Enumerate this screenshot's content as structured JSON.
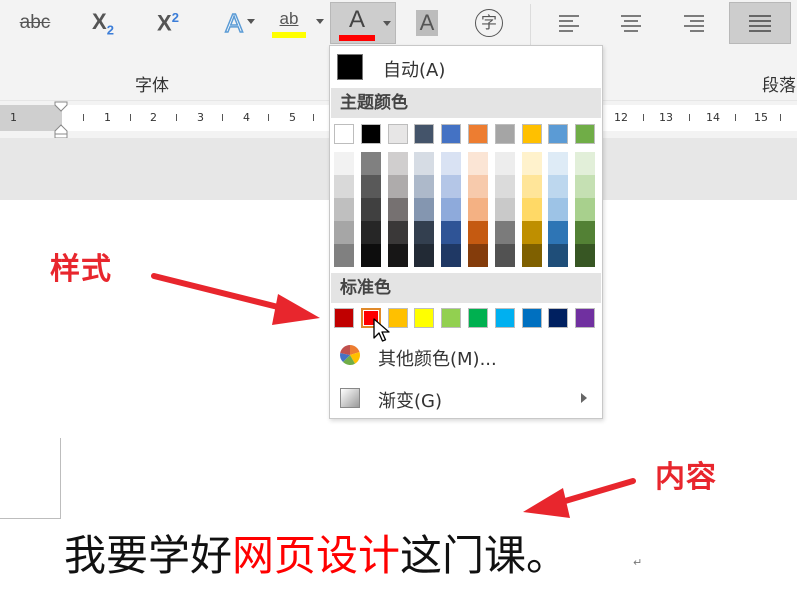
{
  "ribbon": {
    "buttons": {
      "strikethrough": "abc",
      "subscript_main": "X",
      "subscript_sub": "2",
      "superscript_main": "X",
      "superscript_sup": "2",
      "text_effects": "A",
      "highlight": "ab",
      "font_color": "A",
      "char_shading": "A",
      "enclose_char": "字"
    },
    "group_font_label": "字体",
    "group_paragraph_label": "段落",
    "colors": {
      "highlight_bar": "#ffff00",
      "font_color_bar": "#ff0000",
      "text_effect": "#5b9bd5"
    }
  },
  "ruler": {
    "left_label": "1",
    "numbers": [
      "1",
      "2",
      "3",
      "4",
      "5",
      "12",
      "13",
      "14",
      "15"
    ]
  },
  "color_menu": {
    "auto_label": "自动(A)",
    "theme_header": "主题颜色",
    "theme_top_row": [
      "#ffffff",
      "#000000",
      "#e7e6e6",
      "#44546a",
      "#4472c4",
      "#ed7d31",
      "#a5a5a5",
      "#ffc000",
      "#5b9bd5",
      "#70ad47"
    ],
    "theme_shades": [
      [
        "#f2f2f2",
        "#d9d9d9",
        "#bfbfbf",
        "#a6a6a6",
        "#808080"
      ],
      [
        "#808080",
        "#595959",
        "#404040",
        "#262626",
        "#0d0d0d"
      ],
      [
        "#d0cece",
        "#aeabab",
        "#767171",
        "#3a3838",
        "#171616"
      ],
      [
        "#d6dce4",
        "#adb9ca",
        "#8496b0",
        "#333f4f",
        "#222a35"
      ],
      [
        "#d9e2f3",
        "#b4c6e7",
        "#8eaadb",
        "#2f5496",
        "#1f3864"
      ],
      [
        "#fbe5d5",
        "#f7caac",
        "#f4b183",
        "#c55a11",
        "#843c0b"
      ],
      [
        "#ededed",
        "#dbdbdb",
        "#c9c9c9",
        "#7b7b7b",
        "#525252"
      ],
      [
        "#fff2cc",
        "#ffe599",
        "#ffd966",
        "#bf8f00",
        "#7f6000"
      ],
      [
        "#deebf6",
        "#bdd7ee",
        "#9dc3e6",
        "#2e75b5",
        "#1f4e79"
      ],
      [
        "#e2efd9",
        "#c5e0b3",
        "#a8d08d",
        "#538135",
        "#375623"
      ]
    ],
    "standard_header": "标准色",
    "standard_colors": [
      "#c00000",
      "#ff0000",
      "#ffc000",
      "#ffff00",
      "#92d050",
      "#00b050",
      "#00b0f0",
      "#0070c0",
      "#002060",
      "#7030a0"
    ],
    "more_colors_label": "其他颜色(M)...",
    "gradient_label": "渐变(G)"
  },
  "annotations": {
    "style_label": "样式",
    "content_label": "内容"
  },
  "document": {
    "text_before": "我要学好",
    "text_highlight": "网页设计",
    "text_after": "这门课。",
    "highlight_color": "#ff0000",
    "paragraph_mark": "↵"
  }
}
